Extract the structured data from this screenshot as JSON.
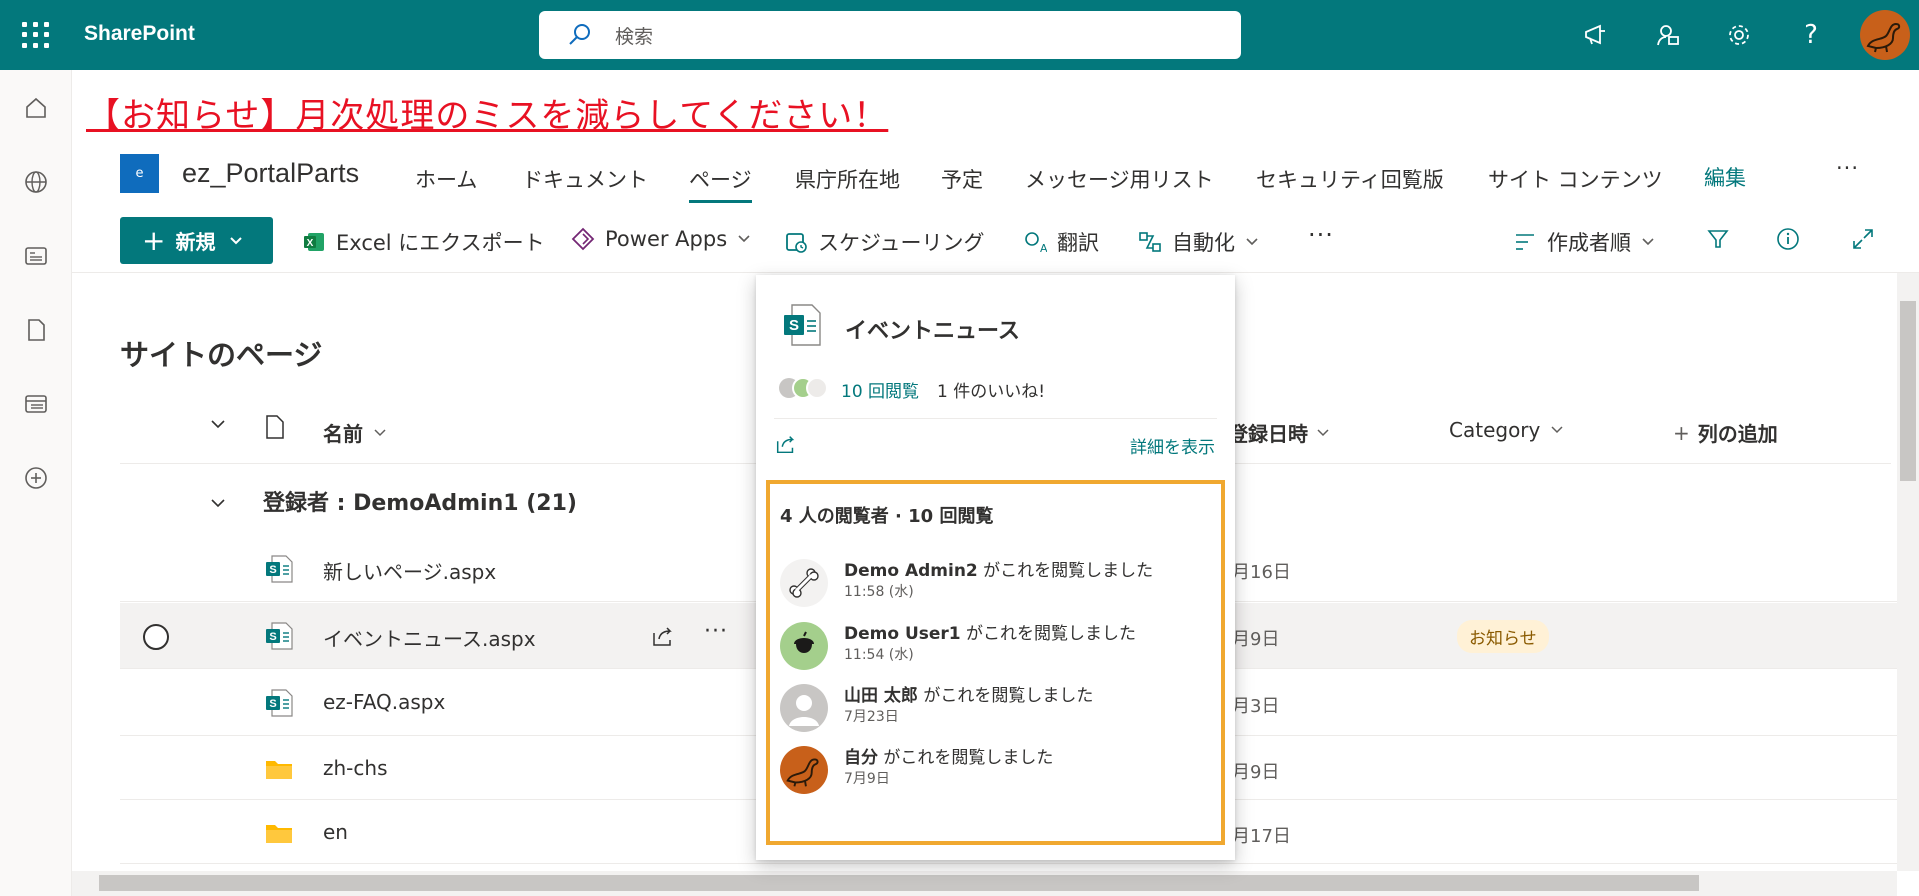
{
  "suite": {
    "app_name": "SharePoint",
    "search_placeholder": "検索"
  },
  "banner": {
    "text": "【お知らせ】月次処理のミスを減らしてください！"
  },
  "site": {
    "logo_letter": "e",
    "name": "ez_PortalParts",
    "nav": [
      "ホーム",
      "ドキュメント",
      "ページ",
      "県庁所在地",
      "予定",
      "メッセージ用リスト",
      "セキュリティ回覧版",
      "サイト コンテンツ",
      "編集"
    ],
    "nav_more": "···"
  },
  "commands": {
    "new_label": "新規",
    "excel": "Excel にエクスポート",
    "powerapps": "Power Apps",
    "schedule": "スケジューリング",
    "translate": "翻訳",
    "automate": "自動化",
    "more": "···",
    "sort": "作成者順"
  },
  "library": {
    "title": "サイトのページ",
    "columns": {
      "name": "名前",
      "created": "登録日時",
      "category": "Category",
      "add_column": "列の追加"
    },
    "group_label": "登録者 : DemoAdmin1 (21)",
    "rows": [
      {
        "name": "新しいページ.aspx",
        "date": "月16日",
        "type": "page",
        "category": ""
      },
      {
        "name": "イベントニュース.aspx",
        "date": "月9日",
        "type": "page",
        "category": "お知らせ"
      },
      {
        "name": "ez-FAQ.aspx",
        "date": "月3日",
        "type": "page",
        "category": ""
      },
      {
        "name": "zh-chs",
        "date": "月9日",
        "type": "folder",
        "category": ""
      },
      {
        "name": "en",
        "date": "月17日",
        "type": "folder",
        "category": ""
      }
    ]
  },
  "card": {
    "title": "イベントニュース",
    "views": "10 回閲覧",
    "likes": "1 件のいいね!",
    "detail_link": "詳細を表示",
    "viewers_header": "4 人の閲覧者 · 10 回閲覧",
    "viewers": [
      {
        "name": "Demo Admin2",
        "action": " がこれを閲覧しました",
        "time": "11:58 (水)",
        "avatar": "bone-icon"
      },
      {
        "name": "Demo User1",
        "action": " がこれを閲覧しました",
        "time": "11:54 (水)",
        "avatar": "acorn-icon"
      },
      {
        "name": "山田 太郎",
        "action": " がこれを閲覧しました",
        "time": "7月23日",
        "avatar": "person-placeholder-icon"
      },
      {
        "name": "自分",
        "action": " がこれを閲覧しました",
        "time": "7月9日",
        "avatar": "dinosaur-icon"
      }
    ]
  },
  "colors": {
    "brand": "#03787c",
    "banner_red": "#e81123",
    "highlight": "#f0a830"
  }
}
